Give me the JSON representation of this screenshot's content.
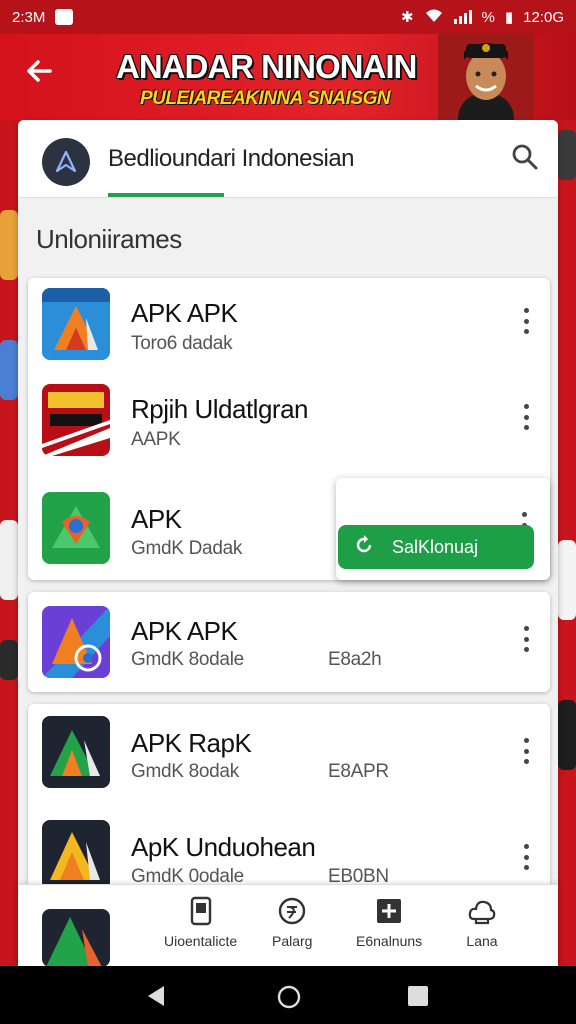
{
  "status_bar": {
    "time": "2:3M",
    "right_time": "12:0G"
  },
  "header": {
    "title": "ANADAR NINONAIN",
    "subtitle": "PULEIAREAKINNA SNAISGN"
  },
  "search": {
    "value": "Bedlioundari Indonesian"
  },
  "section_title": "Unloniirames",
  "apps": [
    {
      "name": "APK APK",
      "subtitle": "Toro6 dadak",
      "size": ""
    },
    {
      "name": "Rpjih Uldatlgran",
      "subtitle": "AAPK",
      "size": ""
    },
    {
      "name": "APK",
      "subtitle": "GmdK Dadak",
      "size": ""
    },
    {
      "name": "APK APK",
      "subtitle": "GmdK 8odale",
      "size": "E8a2h"
    },
    {
      "name": "APK RapK",
      "subtitle": "GmdK 8odak",
      "size": "E8APR"
    },
    {
      "name": "ApK Unduohean",
      "subtitle": "GmdK 0odale",
      "size": "EB0BN"
    }
  ],
  "popup": {
    "button_label": "SalKlonuaj"
  },
  "bottom_nav": [
    {
      "label": "Uioentalicte",
      "icon": "phone-icon"
    },
    {
      "label": "Palarg",
      "icon": "currency-icon"
    },
    {
      "label": "E6nalnuns",
      "icon": "plus-box-icon"
    },
    {
      "label": "Lana",
      "icon": "cloud-icon"
    }
  ],
  "colors": {
    "brand_red": "#d4121c",
    "accent_green": "#1f9e48",
    "banner_yellow": "#ffd21a"
  }
}
